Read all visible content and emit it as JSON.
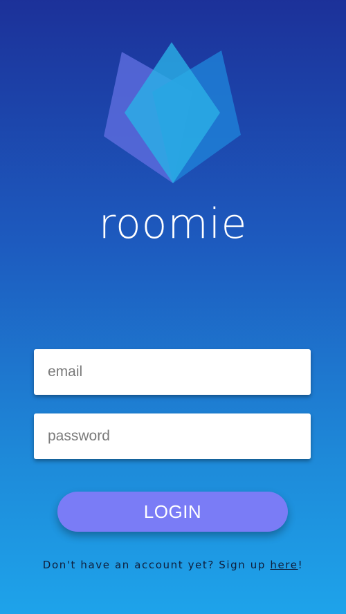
{
  "app": {
    "name": "roomie"
  },
  "colors": {
    "background_top": "#1c3199",
    "background_bottom": "#1ea3ea",
    "button": "#7a7cf6",
    "logo_left_petal": "#5b6bdc",
    "logo_right_petal": "#1e7fd6",
    "logo_center_petal": "#2ab0e6"
  },
  "icons": {
    "logo": "lotus-logo-icon"
  },
  "form": {
    "email_placeholder": "email",
    "password_placeholder": "password",
    "login_label": "LOGIN"
  },
  "signup": {
    "prompt": "Don't have an account yet? Sign up ",
    "link_text": "here",
    "suffix": "!"
  }
}
